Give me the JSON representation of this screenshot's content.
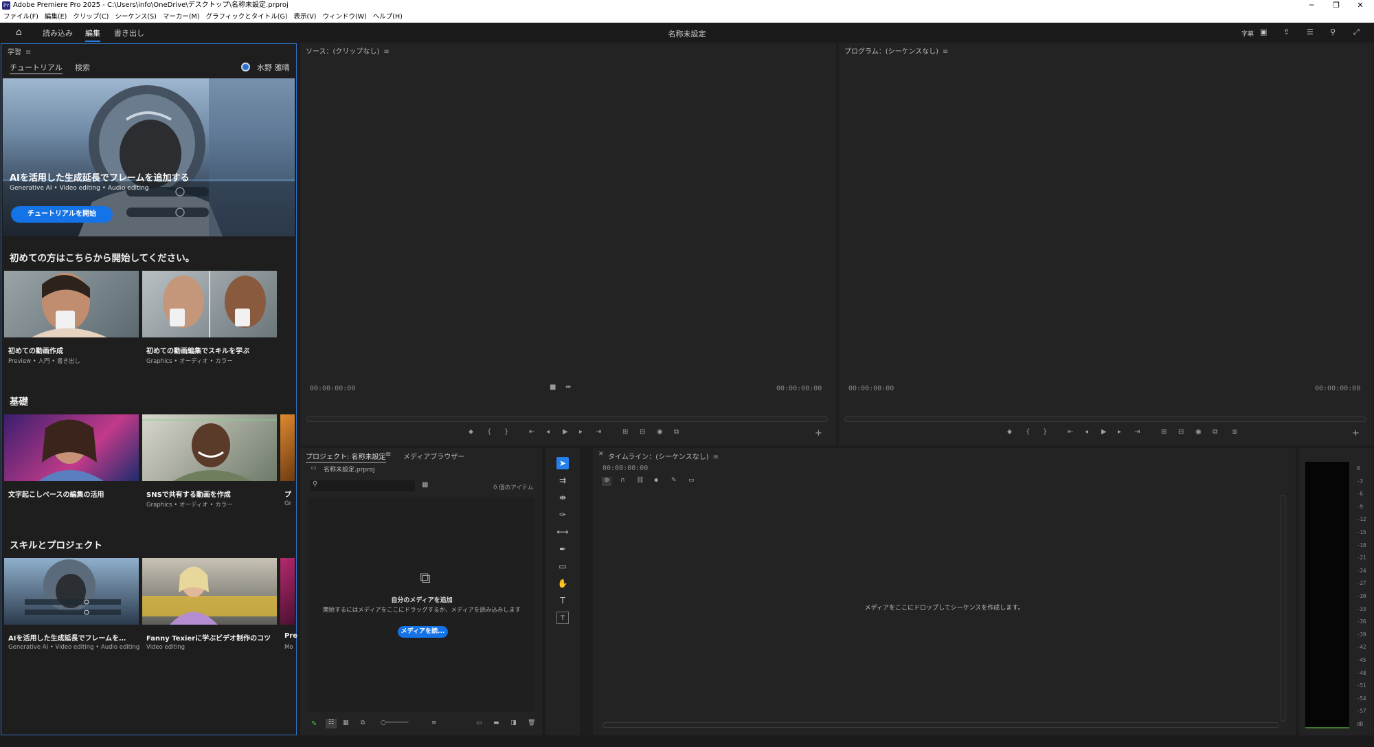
{
  "window": {
    "title": "Adobe Premiere Pro 2025 - C:\\Users\\info\\OneDrive\\デスクトップ\\名称未設定.prproj",
    "app_icon": "Pr",
    "controls": [
      "minimize-icon",
      "restore-icon",
      "close-icon"
    ]
  },
  "menu": [
    "ファイル(F)",
    "編集(E)",
    "クリップ(C)",
    "シーケンス(S)",
    "マーカー(M)",
    "グラフィックとタイトル(G)",
    "表示(V)",
    "ウィンドウ(W)",
    "ヘルプ(H)"
  ],
  "header": {
    "tabs": [
      "読み込み",
      "編集",
      "書き出し"
    ],
    "active_tab": "編集",
    "doc_title": "名称未設定",
    "right_icons": [
      "captions-icon",
      "panel-layout-icon",
      "share-icon",
      "workspaces-icon",
      "search-icon",
      "fullscreen-icon"
    ],
    "right_icon_captions": "字幕"
  },
  "learn": {
    "panel_title": "学習",
    "tabs": [
      "チュートリアル",
      "検索"
    ],
    "user": "水野 雅晴",
    "hero": {
      "title": "AIを活用した生成延長でフレームを追加する",
      "subtitle": "Generative AI • Video editing • Audio editing",
      "button": "チュートリアルを開始"
    },
    "sections": [
      {
        "heading": "初めての方はこちらから開始してください。",
        "cards": [
          {
            "title": "初めての動画作成",
            "sub": "Preview • 入門 • 書き出し"
          },
          {
            "title": "初めての動画編集でスキルを学ぶ",
            "sub": "Graphics • オーディオ • カラー"
          }
        ]
      },
      {
        "heading": "基礎",
        "cards": [
          {
            "title": "文字起こしベースの編集の活用",
            "sub": ""
          },
          {
            "title": "SNSで共有する動画を作成",
            "sub": "Graphics • オーディオ • カラー"
          },
          {
            "title": "プ",
            "sub": "Gr"
          }
        ]
      },
      {
        "heading": "スキルとプロジェクト",
        "cards": [
          {
            "title": "AIを活用した生成延長でフレームを…",
            "sub": "Generative AI • Video editing • Audio editing"
          },
          {
            "title": "Fanny Texierに学ぶビデオ制作のコツ",
            "sub": "Video editing"
          },
          {
            "title": "Pre",
            "sub": "Mo"
          }
        ]
      }
    ]
  },
  "source": {
    "title": "ソース：(クリップなし)",
    "tc_left": "00:00:00:00",
    "tc_right": "00:00:00:00"
  },
  "program": {
    "title": "プログラム：(シーケンスなし)",
    "tc_left": "00:00:00:00",
    "tc_right": "00:00:00:00"
  },
  "project": {
    "tabs": [
      "プロジェクト: 名称未設定",
      "メディアブラウザー"
    ],
    "file": "名称未設定.prproj",
    "item_count": "0 個のアイテム",
    "empty_title": "自分のメディアを追加",
    "empty_desc": "開始するにはメディアをここにドラッグするか、メディアを読み込みします",
    "import_button": "メディアを読..."
  },
  "tools": [
    "selection-tool-icon",
    "track-select-icon",
    "ripple-edit-icon",
    "razor-icon",
    "slip-icon",
    "pen-icon",
    "rectangle-icon",
    "hand-icon",
    "type-icon",
    "caption-tool-icon"
  ],
  "timeline": {
    "title": "タイムライン：(シーケンスなし)",
    "timecode": "00:00:00:00",
    "drop_hint": "メディアをここにドロップしてシーケンスを作成します。"
  },
  "meter": {
    "scale": [
      "0",
      "-3",
      "-6",
      "-9",
      "-12",
      "-15",
      "-18",
      "-21",
      "-24",
      "-27",
      "-30",
      "-33",
      "-36",
      "-39",
      "-42",
      "-45",
      "-48",
      "-51",
      "-54",
      "-57",
      "dB"
    ]
  }
}
